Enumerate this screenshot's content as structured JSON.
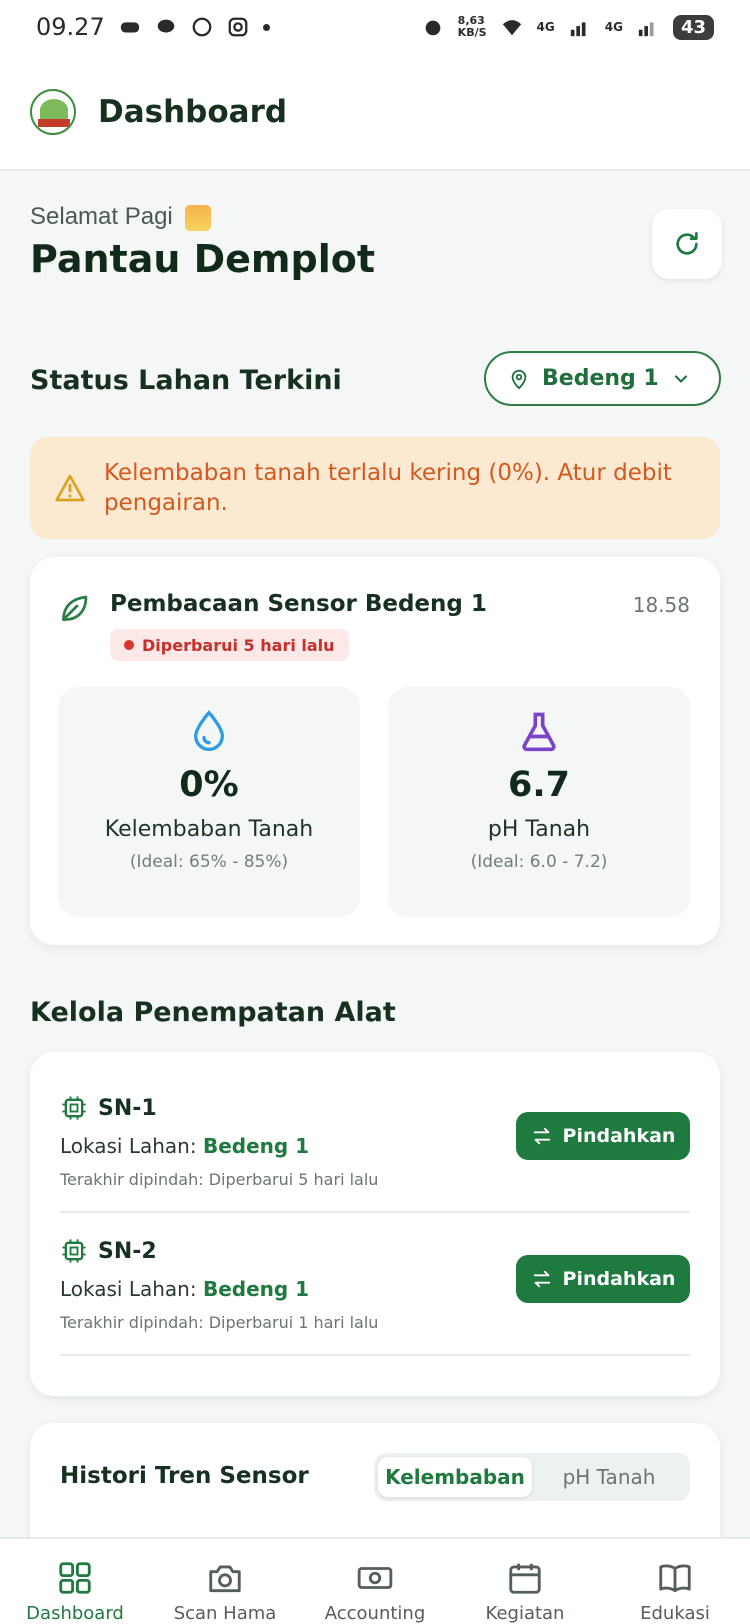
{
  "status_bar": {
    "time": "09.27",
    "net_speed": "8,63",
    "net_unit": "KB/S",
    "sig1": "4G",
    "sig2": "4G",
    "battery": "43"
  },
  "header": {
    "title": "Dashboard"
  },
  "greeting": {
    "text": "Selamat Pagi",
    "name": "Pantau Demplot"
  },
  "status_section": {
    "title": "Status Lahan Terkini",
    "selected_bed": "Bedeng 1"
  },
  "alert": {
    "text": "Kelembaban tanah terlalu kering (0%). Atur debit pengairan."
  },
  "sensor": {
    "title": "Pembacaan Sensor Bedeng 1",
    "time": "18.58",
    "updated": "Diperbarui 5 hari lalu",
    "moisture": {
      "value": "0%",
      "label": "Kelembaban Tanah",
      "ideal": "(Ideal: 65% - 85%)"
    },
    "ph": {
      "value": "6.7",
      "label": "pH Tanah",
      "ideal": "(Ideal: 6.0 - 7.2)"
    }
  },
  "devices_section": {
    "title": "Kelola Penempatan Alat",
    "location_prefix": "Lokasi Lahan:",
    "items": [
      {
        "name": "SN-1",
        "location": "Bedeng 1",
        "moved": "Terakhir dipindah: Diperbarui 5 hari lalu",
        "button": "Pindahkan"
      },
      {
        "name": "SN-2",
        "location": "Bedeng 1",
        "moved": "Terakhir dipindah: Diperbarui 1 hari lalu",
        "button": "Pindahkan"
      }
    ]
  },
  "history": {
    "title": "Histori Tren Sensor",
    "tabs": [
      "Kelembaban",
      "pH Tanah"
    ]
  },
  "nav": {
    "items": [
      "Dashboard",
      "Scan Hama",
      "Accounting",
      "Kegiatan",
      "Edukasi"
    ]
  },
  "colors": {
    "primary": "#1f7a3f",
    "warning_bg": "#fbe9d2",
    "warning_text": "#d2591f",
    "alert_red": "#c7302a"
  },
  "icons": {
    "refresh": "refresh-icon",
    "location": "location-pin-icon",
    "chevron": "chevron-down-icon",
    "warning": "warning-triangle-icon",
    "leaf": "leaf-icon",
    "drop": "water-drop-icon",
    "flask": "flask-icon",
    "chip": "chip-icon",
    "swap": "swap-arrows-icon"
  }
}
